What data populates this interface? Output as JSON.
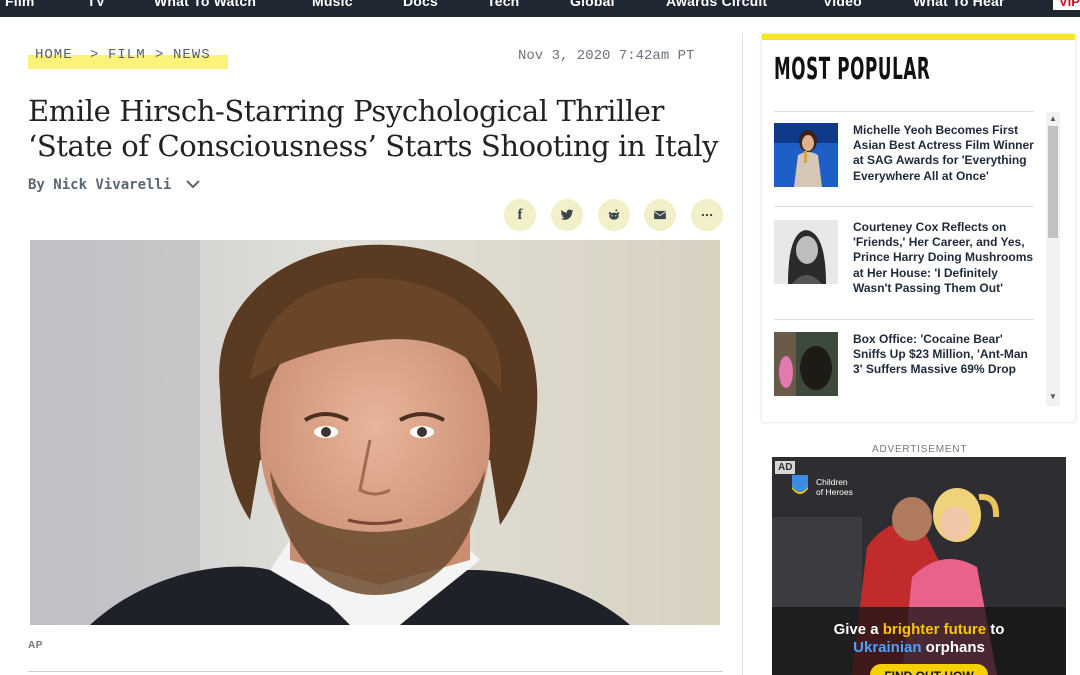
{
  "nav": {
    "items": [
      "Film",
      "TV",
      "What To Watch",
      "Music",
      "Docs",
      "Tech",
      "Global",
      "Awards Circuit",
      "Video",
      "What To Hear"
    ],
    "vip_label": "VIP"
  },
  "article": {
    "breadcrumb": {
      "home": "HOME",
      "sep1": ">",
      "section": "FILM",
      "sep2": ">",
      "sub": "NEWS"
    },
    "date": "Nov 3, 2020 7:42am PT",
    "title": "Emile Hirsch-Starring Psychological Thriller ‘State of Consciousness’ Starts Shooting in Italy",
    "byline": "By Nick Vivarelli",
    "caption": "AP",
    "share": [
      "facebook-icon",
      "twitter-icon",
      "reddit-icon",
      "email-icon",
      "more-icon"
    ]
  },
  "sidebar": {
    "most_popular_title": "MOST POPULAR",
    "stories": [
      {
        "text": "Michelle Yeoh Becomes First Asian Best Actress Film Winner at SAG Awards for 'Everything Everywhere All at Once'"
      },
      {
        "text": "Courteney Cox Reflects on 'Friends,' Her Career, and Yes, Prince Harry Doing Mushrooms at Her House: 'I Definitely Wasn't Passing Them Out'"
      },
      {
        "text": "Box Office: 'Cocaine Bear' Sniffs Up $23 Million, 'Ant-Man 3' Suffers Massive 69% Drop"
      }
    ],
    "ad_label": "ADVERTISEMENT",
    "ad": {
      "badge": "AD",
      "org_line1": "Children",
      "org_line2": "of Heroes",
      "head_1": "Give a ",
      "head_2": "brighter future",
      "head_3": " to",
      "head_4": "Ukrainian",
      "head_5": " orphans",
      "cta": "FIND OUT HOW"
    }
  },
  "colors": {
    "nav_bg": "#1f2733",
    "highlight": "#fbf27a",
    "accent_yellow": "#f8e71c",
    "share_bg": "#f2f0c8"
  }
}
